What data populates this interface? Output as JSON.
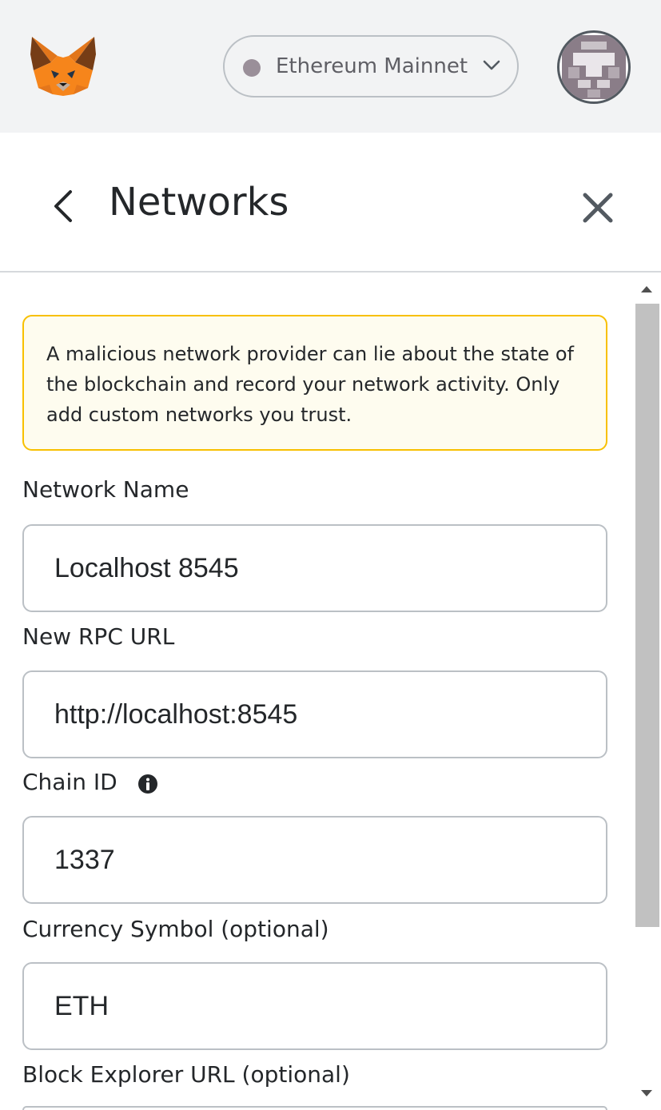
{
  "app_bar": {
    "network": {
      "label": "Ethereum Mainnet",
      "dot_color": "#9a8f99"
    },
    "logo_icon": "metamask-fox-icon",
    "avatar_icon": "account-identicon"
  },
  "header": {
    "title": "Networks",
    "back_icon": "chevron-left-icon",
    "close_icon": "close-icon"
  },
  "warning": {
    "text": "A malicious network provider can lie about the state of the blockchain and record your network activity. Only add custom networks you trust.",
    "border_color": "#f8c000",
    "background_color": "#fefcef"
  },
  "form": {
    "network_name": {
      "label": "Network Name",
      "value": "Localhost 8545"
    },
    "rpc_url": {
      "label": "New RPC URL",
      "value": "http://localhost:8545"
    },
    "chain_id": {
      "label": "Chain ID",
      "value": "1337",
      "info_icon": "info-icon"
    },
    "currency_symbol": {
      "label": "Currency Symbol (optional)",
      "value": "ETH"
    },
    "block_explorer": {
      "label": "Block Explorer URL (optional)"
    }
  }
}
